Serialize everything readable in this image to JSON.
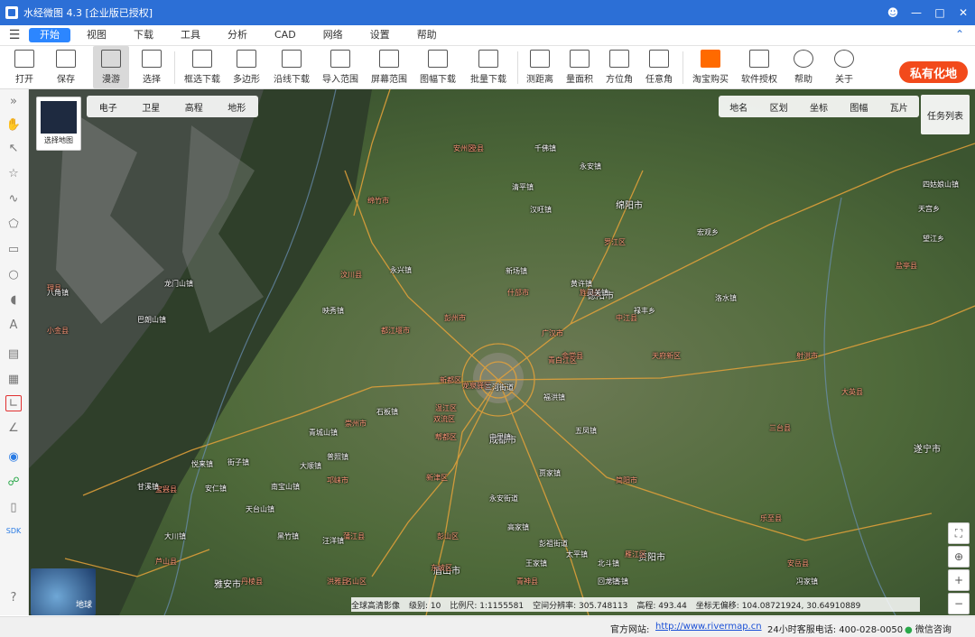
{
  "app": {
    "title": "水经微图 4.3 [企业版已授权]"
  },
  "menu": [
    "开始",
    "视图",
    "下载",
    "工具",
    "分析",
    "CAD",
    "网络",
    "设置",
    "帮助"
  ],
  "toolbar": [
    {
      "label": "打开",
      "icon": "folder-icon"
    },
    {
      "label": "保存",
      "icon": "save-icon"
    },
    {
      "label": "漫游",
      "icon": "hand-icon"
    },
    {
      "label": "选择",
      "icon": "cursor-icon"
    },
    {
      "label": "框选下载",
      "icon": "box-download-icon"
    },
    {
      "label": "多边形",
      "icon": "polygon-icon"
    },
    {
      "label": "沿线下载",
      "icon": "line-download-icon"
    },
    {
      "label": "导入范围",
      "icon": "import-icon"
    },
    {
      "label": "屏幕范围",
      "icon": "screen-icon"
    },
    {
      "label": "图幅下载",
      "icon": "grid-download-icon"
    },
    {
      "label": "批量下载",
      "icon": "batch-download-icon"
    },
    {
      "label": "测距离",
      "icon": "ruler-icon"
    },
    {
      "label": "量面积",
      "icon": "area-icon"
    },
    {
      "label": "方位角",
      "icon": "azimuth-icon"
    },
    {
      "label": "任意角",
      "icon": "angle-icon"
    },
    {
      "label": "淘宝购买",
      "icon": "taobao-icon"
    },
    {
      "label": "软件授权",
      "icon": "lock-icon"
    },
    {
      "label": "帮助",
      "icon": "help-icon"
    },
    {
      "label": "关于",
      "icon": "info-icon"
    }
  ],
  "brand": "私有化地",
  "map_tabs_left": [
    "电子",
    "卫星",
    "高程",
    "地形"
  ],
  "map_tabs_right": [
    "地名",
    "区划",
    "坐标",
    "图幅",
    "瓦片"
  ],
  "task_list": "任务列表",
  "thumb_label": "选择地图",
  "globe_label": "地球",
  "status": {
    "imagery": "全球高清影像",
    "level": "级别: 10",
    "scale": "比例尺: 1:1155581",
    "resolution": "空间分辨率: 305.748113",
    "elevation": "高程: 493.44",
    "coords": "坐标无偏移: 104.08721924, 30.64910889"
  },
  "footer": {
    "site_label": "官方网站:",
    "site_url": "http://www.rivermap.cn",
    "hotline": "24小时客服电话: 400-028-0050",
    "wechat": "微信咨询"
  },
  "places": [
    {
      "t": "成都市",
      "c": "w",
      "big": true
    },
    {
      "t": "德阳市",
      "c": "w",
      "big": true
    },
    {
      "t": "绵阳市",
      "c": "w",
      "big": true
    },
    {
      "t": "资阳市",
      "c": "w",
      "big": true
    },
    {
      "t": "眉山市",
      "c": "w",
      "big": true
    },
    {
      "t": "雅安市",
      "c": "w",
      "big": true
    },
    {
      "t": "遂宁市",
      "c": "w",
      "big": true
    },
    {
      "t": "都江堰市",
      "c": "r"
    },
    {
      "t": "彭州市",
      "c": "r"
    },
    {
      "t": "广汉市",
      "c": "r"
    },
    {
      "t": "什邡市",
      "c": "r"
    },
    {
      "t": "绵竹市",
      "c": "r"
    },
    {
      "t": "罗江区",
      "c": "r"
    },
    {
      "t": "中江县",
      "c": "r"
    },
    {
      "t": "金堂县",
      "c": "r"
    },
    {
      "t": "简阳市",
      "c": "r"
    },
    {
      "t": "邛崃市",
      "c": "r"
    },
    {
      "t": "崇州市",
      "c": "r"
    },
    {
      "t": "大邑县",
      "c": "r"
    },
    {
      "t": "新津区",
      "c": "r"
    },
    {
      "t": "彭山区",
      "c": "r"
    },
    {
      "t": "蒲江县",
      "c": "r"
    },
    {
      "t": "名山区",
      "c": "r"
    },
    {
      "t": "芦山县",
      "c": "r"
    },
    {
      "t": "宝兴县",
      "c": "r"
    },
    {
      "t": "汶川县",
      "c": "r"
    },
    {
      "t": "茂县",
      "c": "r"
    },
    {
      "t": "安州区",
      "c": "r"
    },
    {
      "t": "三台县",
      "c": "r"
    },
    {
      "t": "射洪市",
      "c": "r"
    },
    {
      "t": "乐至县",
      "c": "r"
    },
    {
      "t": "安岳县",
      "c": "r"
    },
    {
      "t": "青神县",
      "c": "r"
    },
    {
      "t": "丹棱县",
      "c": "r"
    },
    {
      "t": "洪雅县",
      "c": "r"
    },
    {
      "t": "大英县",
      "c": "r"
    },
    {
      "t": "天府新区",
      "c": "r"
    },
    {
      "t": "小金县",
      "c": "r"
    },
    {
      "t": "理县",
      "c": "r"
    },
    {
      "t": "温江区",
      "c": "r"
    },
    {
      "t": "双流区",
      "c": "r"
    },
    {
      "t": "郫都区",
      "c": "r"
    },
    {
      "t": "新都区",
      "c": "r"
    },
    {
      "t": "青白江区",
      "c": "r"
    },
    {
      "t": "龙泉驿区",
      "c": "r"
    },
    {
      "t": "旌阳区",
      "c": "r"
    },
    {
      "t": "东坡区",
      "c": "r"
    },
    {
      "t": "雁江区",
      "c": "r"
    },
    {
      "t": "盐亭县",
      "c": "r"
    },
    {
      "t": "千佛镇",
      "c": "w"
    },
    {
      "t": "永安镇",
      "c": "w"
    },
    {
      "t": "新场镇",
      "c": "w"
    },
    {
      "t": "黄许镇",
      "c": "w"
    },
    {
      "t": "三河街道",
      "c": "w"
    },
    {
      "t": "福洪镇",
      "c": "w"
    },
    {
      "t": "五凤镇",
      "c": "w"
    },
    {
      "t": "贾家镇",
      "c": "w"
    },
    {
      "t": "永安街道",
      "c": "w"
    },
    {
      "t": "高家镇",
      "c": "w"
    },
    {
      "t": "彭祖街道",
      "c": "w"
    },
    {
      "t": "丰谷镇",
      "c": "w"
    },
    {
      "t": "回龙镇",
      "c": "w"
    },
    {
      "t": "太平镇",
      "c": "w"
    },
    {
      "t": "黑竹镇",
      "c": "w"
    },
    {
      "t": "八角镇",
      "c": "w"
    },
    {
      "t": "映秀镇",
      "c": "w"
    },
    {
      "t": "清平镇",
      "c": "w"
    },
    {
      "t": "汉旺镇",
      "c": "w"
    },
    {
      "t": "南宝山镇",
      "c": "w"
    },
    {
      "t": "天台山镇",
      "c": "w"
    },
    {
      "t": "王家镇",
      "c": "w"
    },
    {
      "t": "北斗镇",
      "c": "w"
    },
    {
      "t": "冯家镇",
      "c": "w"
    },
    {
      "t": "永兴镇",
      "c": "w"
    },
    {
      "t": "龙门山镇",
      "c": "w"
    },
    {
      "t": "巴朗山镇",
      "c": "w"
    },
    {
      "t": "四姑娘山镇",
      "c": "w"
    },
    {
      "t": "望江乡",
      "c": "w"
    },
    {
      "t": "天宫乡",
      "c": "w"
    },
    {
      "t": "宏观乡",
      "c": "w"
    },
    {
      "t": "洛水镇",
      "c": "w"
    },
    {
      "t": "禄丰乡",
      "c": "w"
    },
    {
      "t": "大顺镇",
      "c": "w"
    },
    {
      "t": "石板镇",
      "c": "w"
    },
    {
      "t": "汪洋镇",
      "c": "w"
    },
    {
      "t": "青城山镇",
      "c": "w"
    },
    {
      "t": "普照镇",
      "c": "w"
    },
    {
      "t": "街子镇",
      "c": "w"
    },
    {
      "t": "悦来镇",
      "c": "w"
    },
    {
      "t": "安仁镇",
      "c": "w"
    },
    {
      "t": "甘溪镇",
      "c": "w"
    },
    {
      "t": "大川镇",
      "c": "w"
    },
    {
      "t": "中里镇",
      "c": "w"
    },
    {
      "t": "灵关镇",
      "c": "w"
    }
  ]
}
